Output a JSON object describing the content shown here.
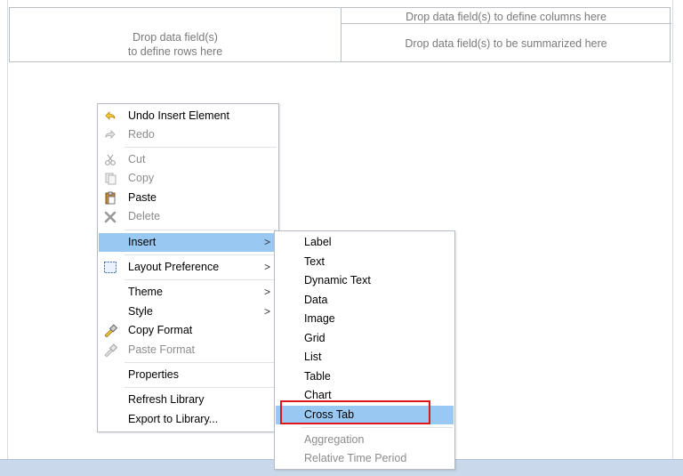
{
  "crosstab": {
    "columns_hint": "Drop data field(s) to define columns here",
    "rows_hint_line1": "Drop data field(s)",
    "rows_hint_line2": "to define rows here",
    "summary_hint": "Drop data field(s) to be summarized here"
  },
  "context_menu": {
    "undo": "Undo Insert Element",
    "redo": "Redo",
    "cut": "Cut",
    "copy": "Copy",
    "paste": "Paste",
    "delete": "Delete",
    "insert": "Insert",
    "layout_preference": "Layout Preference",
    "theme": "Theme",
    "style": "Style",
    "copy_format": "Copy Format",
    "paste_format": "Paste Format",
    "properties": "Properties",
    "refresh_library": "Refresh Library",
    "export_to_library": "Export to Library...",
    "submenu_arrow": ">"
  },
  "insert_submenu": {
    "label": "Label",
    "text": "Text",
    "dynamic_text": "Dynamic Text",
    "data": "Data",
    "image": "Image",
    "grid": "Grid",
    "list": "List",
    "table": "Table",
    "chart": "Chart",
    "cross_tab": "Cross Tab",
    "aggregation": "Aggregation",
    "relative_time_period": "Relative Time Period"
  },
  "colors": {
    "highlight": "#99c9f3",
    "focus_outline": "#e0161e",
    "disabled_text": "#8c8c8c"
  },
  "icons": [
    "undo-icon",
    "redo-icon",
    "cut-icon",
    "copy-icon",
    "paste-icon",
    "delete-icon",
    "layout-preference-icon",
    "copy-format-icon",
    "paste-format-icon"
  ]
}
